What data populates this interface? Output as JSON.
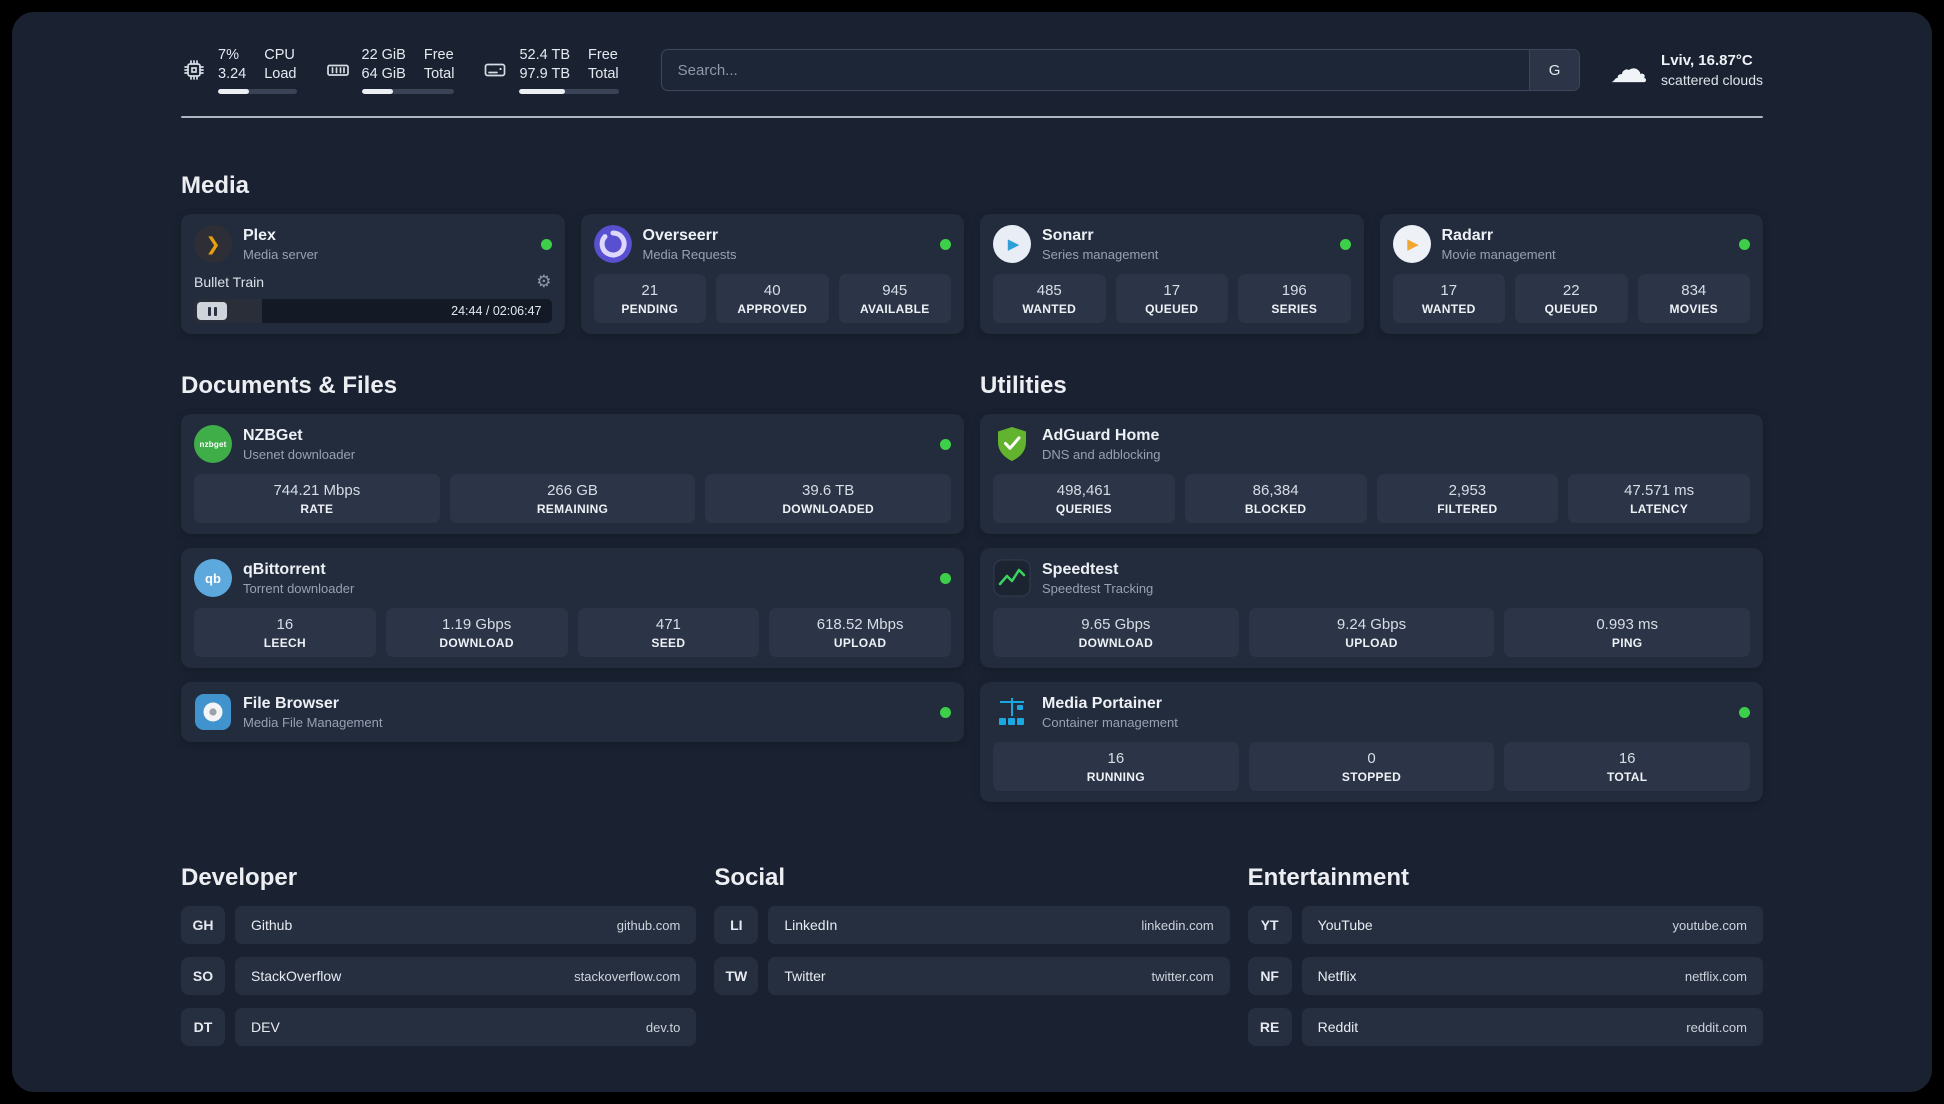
{
  "theme": {
    "page_bg": "#1a2232",
    "card_bg": "#232c3d",
    "tile_bg": "#2c3547",
    "status_online": "#3ecf4a",
    "divider": "#c9cfd8"
  },
  "icons": {
    "cloud": "☁",
    "gear": "⚙",
    "plex_glyph": "❯",
    "play_glyph": "▶"
  },
  "header": {
    "cpu": {
      "values": [
        "7%",
        "3.24"
      ],
      "labels": [
        "CPU",
        "Load"
      ],
      "bar_pct": 40
    },
    "ram": {
      "values": [
        "22 GiB",
        "64 GiB"
      ],
      "labels": [
        "Free",
        "Total"
      ],
      "bar_pct": 34
    },
    "disk": {
      "values": [
        "52.4 TB",
        "97.9 TB"
      ],
      "labels": [
        "Free",
        "Total"
      ],
      "bar_pct": 46
    },
    "search": {
      "placeholder": "Search...",
      "button_label": "G"
    },
    "weather": {
      "location": "Lviv, 16.87°C",
      "condition": "scattered clouds"
    }
  },
  "media": {
    "title": "Media",
    "plex": {
      "name": "Plex",
      "subtitle": "Media server",
      "status": "online",
      "player_title": "Bullet Train",
      "time": "24:44 / 02:06:47",
      "progress_pct": 19
    },
    "overseerr": {
      "name": "Overseerr",
      "subtitle": "Media Requests",
      "status": "online",
      "stats": [
        {
          "value": "21",
          "label": "PENDING"
        },
        {
          "value": "40",
          "label": "APPROVED"
        },
        {
          "value": "945",
          "label": "AVAILABLE"
        }
      ]
    },
    "sonarr": {
      "name": "Sonarr",
      "subtitle": "Series management",
      "status": "online",
      "stats": [
        {
          "value": "485",
          "label": "WANTED"
        },
        {
          "value": "17",
          "label": "QUEUED"
        },
        {
          "value": "196",
          "label": "SERIES"
        }
      ]
    },
    "radarr": {
      "name": "Radarr",
      "subtitle": "Movie management",
      "status": "online",
      "stats": [
        {
          "value": "17",
          "label": "WANTED"
        },
        {
          "value": "22",
          "label": "QUEUED"
        },
        {
          "value": "834",
          "label": "MOVIES"
        }
      ]
    }
  },
  "documents": {
    "title": "Documents & Files",
    "nzbget": {
      "name": "NZBGet",
      "subtitle": "Usenet downloader",
      "status": "online",
      "icon_text": "nzbget",
      "stats": [
        {
          "value": "744.21 Mbps",
          "label": "RATE"
        },
        {
          "value": "266 GB",
          "label": "REMAINING"
        },
        {
          "value": "39.6 TB",
          "label": "DOWNLOADED"
        }
      ]
    },
    "qbittorrent": {
      "name": "qBittorrent",
      "subtitle": "Torrent downloader",
      "status": "online",
      "icon_text": "qb",
      "stats": [
        {
          "value": "16",
          "label": "LEECH"
        },
        {
          "value": "1.19 Gbps",
          "label": "DOWNLOAD"
        },
        {
          "value": "471",
          "label": "SEED"
        },
        {
          "value": "618.52 Mbps",
          "label": "UPLOAD"
        }
      ]
    },
    "filebrowser": {
      "name": "File Browser",
      "subtitle": "Media File Management",
      "status": "online"
    }
  },
  "utilities": {
    "title": "Utilities",
    "adguard": {
      "name": "AdGuard Home",
      "subtitle": "DNS and adblocking",
      "stats": [
        {
          "value": "498,461",
          "label": "QUERIES"
        },
        {
          "value": "86,384",
          "label": "BLOCKED"
        },
        {
          "value": "2,953",
          "label": "FILTERED"
        },
        {
          "value": "47.571 ms",
          "label": "LATENCY"
        }
      ]
    },
    "speedtest": {
      "name": "Speedtest",
      "subtitle": "Speedtest Tracking",
      "stats": [
        {
          "value": "9.65 Gbps",
          "label": "DOWNLOAD"
        },
        {
          "value": "9.24 Gbps",
          "label": "UPLOAD"
        },
        {
          "value": "0.993 ms",
          "label": "PING"
        }
      ]
    },
    "portainer": {
      "name": "Media Portainer",
      "subtitle": "Container management",
      "status": "online",
      "stats": [
        {
          "value": "16",
          "label": "RUNNING"
        },
        {
          "value": "0",
          "label": "STOPPED"
        },
        {
          "value": "16",
          "label": "TOTAL"
        }
      ]
    }
  },
  "bookmarks": [
    {
      "title": "Developer",
      "items": [
        {
          "abbr": "GH",
          "name": "Github",
          "url": "github.com"
        },
        {
          "abbr": "SO",
          "name": "StackOverflow",
          "url": "stackoverflow.com"
        },
        {
          "abbr": "DT",
          "name": "DEV",
          "url": "dev.to"
        }
      ]
    },
    {
      "title": "Social",
      "items": [
        {
          "abbr": "LI",
          "name": "LinkedIn",
          "url": "linkedin.com"
        },
        {
          "abbr": "TW",
          "name": "Twitter",
          "url": "twitter.com"
        }
      ]
    },
    {
      "title": "Entertainment",
      "items": [
        {
          "abbr": "YT",
          "name": "YouTube",
          "url": "youtube.com"
        },
        {
          "abbr": "NF",
          "name": "Netflix",
          "url": "netflix.com"
        },
        {
          "abbr": "RE",
          "name": "Reddit",
          "url": "reddit.com"
        }
      ]
    }
  ]
}
